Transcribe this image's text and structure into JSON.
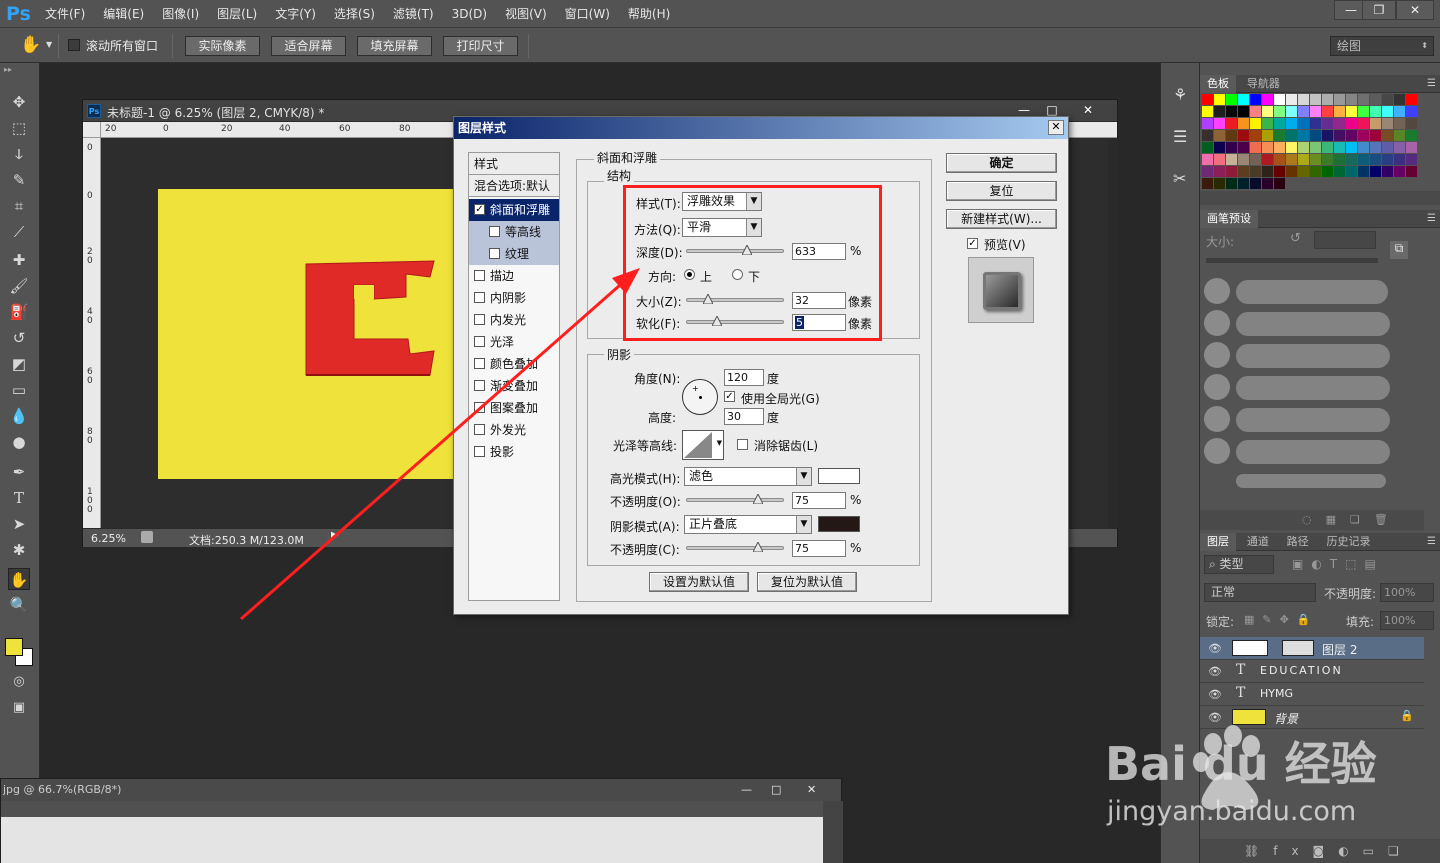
{
  "menubar": {
    "logo": "Ps",
    "items": [
      "文件(F)",
      "编辑(E)",
      "图像(I)",
      "图层(L)",
      "文字(Y)",
      "选择(S)",
      "滤镜(T)",
      "3D(D)",
      "视图(V)",
      "窗口(W)",
      "帮助(H)"
    ],
    "window_controls": [
      "—",
      "❐",
      "✕"
    ]
  },
  "options": {
    "scroll_all": "滚动所有窗口",
    "actual_pixels": "实际像素",
    "fit_screen": "适合屏幕",
    "fill_screen": "填充屏幕",
    "print_size": "打印尺寸",
    "workspace": "绘图"
  },
  "document": {
    "title": "未标题-1 @ 6.25% (图层 2, CMYK/8) *",
    "badge": "Ps",
    "zoom": "6.25%",
    "doc_info": "文档:250.3 M/123.0M",
    "ruler_h": [
      "20",
      "0",
      "20",
      "40",
      "60",
      "80"
    ],
    "ruler_v": [
      "0",
      "0",
      "20",
      "40",
      "60",
      "80",
      "100"
    ],
    "controls": [
      "—",
      "□",
      "✕"
    ]
  },
  "document2": {
    "title": "jpg @ 66.7%(RGB/8*)",
    "controls": [
      "—",
      "□",
      "✕"
    ]
  },
  "panels": {
    "swatches_tabs": [
      "色板",
      "导航器"
    ],
    "brush_tab": "画笔预设",
    "brush_size_label": "大小:",
    "layers_tabs": [
      "图层",
      "通道",
      "路径",
      "历史记录"
    ],
    "filter_type": "类型",
    "blend_mode": "正常",
    "opacity_label": "不透明度:",
    "opacity_value": "100%",
    "lock_label": "锁定:",
    "fill_label": "填充:",
    "fill_value": "100%",
    "layers": [
      {
        "name": "图层 2",
        "kind": "image"
      },
      {
        "name": "EDUCATION",
        "kind": "text"
      },
      {
        "name": "HYMG",
        "kind": "text"
      },
      {
        "name": "背景",
        "kind": "background"
      }
    ],
    "swatch_colors": [
      "#ff0000",
      "#ffff00",
      "#00ff00",
      "#00ffff",
      "#0000ff",
      "#ff00ff",
      "#ffffff",
      "#ebebeb",
      "#d6d6d6",
      "#c2c2c2",
      "#adadad",
      "#999999",
      "#858585",
      "#707070",
      "#5c5c5c",
      "#474747",
      "#333333",
      "#ff0000",
      "#ffff00",
      "#1f1f1f",
      "#0a0a0a",
      "#000000",
      "#ff8080",
      "#ffff80",
      "#80ff80",
      "#80ffff",
      "#8080ff",
      "#ff80ff",
      "#ff4040",
      "#ffb040",
      "#ffff40",
      "#40ff40",
      "#40ffb0",
      "#40ffff",
      "#40b0ff",
      "#4040ff",
      "#b040ff",
      "#ff40ff",
      "#ed1c24",
      "#f7941d",
      "#fff200",
      "#39b54a",
      "#00a99d",
      "#00aeef",
      "#0072bc",
      "#2e3192",
      "#662d91",
      "#92278f",
      "#ec008c",
      "#ed145b",
      "#c69c6d",
      "#998675",
      "#736357",
      "#534741",
      "#362f2d",
      "#8c6239",
      "#603913",
      "#9e0b0f",
      "#a0410d",
      "#aba000",
      "#197b30",
      "#00746b",
      "#0076a3",
      "#004a80",
      "#1b1464",
      "#440e62",
      "#630460",
      "#9e005d",
      "#9e0039",
      "#754c24",
      "#598527",
      "#1a7b30",
      "#005e20",
      "#0d004c",
      "#32004b",
      "#4b0049",
      "#f26c4f",
      "#f68e55",
      "#fbaf5c",
      "#fff467",
      "#acd372",
      "#7cc576",
      "#3bb878",
      "#1abbb4",
      "#00bff3",
      "#438ccb",
      "#5574b9",
      "#605ca8",
      "#855fa8",
      "#a763a8",
      "#f06ea9",
      "#f26d7d",
      "#c7b299",
      "#998675",
      "#736357",
      "#aa1b22",
      "#a8521b",
      "#ab7a1b",
      "#adaa1a",
      "#6b8e23",
      "#3a7d28",
      "#1e6f38",
      "#16695c",
      "#0c5c7a",
      "#1a4e82",
      "#2a3f83",
      "#3a2f80",
      "#552b80",
      "#6e2a74",
      "#8a1f5a",
      "#8f1b3a",
      "#5c3d1e",
      "#4a3a28",
      "#2e2318",
      "#660000",
      "#663300",
      "#666600",
      "#336600",
      "#006600",
      "#006633",
      "#006666",
      "#003366",
      "#000066",
      "#330066",
      "#660066",
      "#660033",
      "#3a1a0a",
      "#2a2a00",
      "#002a1a",
      "#00202a",
      "#0a0a2a",
      "#2a002a",
      "#2a0010"
    ]
  },
  "dialog": {
    "title": "图层样式",
    "styles": [
      {
        "label": "样式",
        "checkbox": false,
        "state": "header"
      },
      {
        "label": "混合选项:默认",
        "checkbox": false,
        "state": "header"
      },
      {
        "label": "斜面和浮雕",
        "checkbox": true,
        "checked": true,
        "state": "selected"
      },
      {
        "label": "等高线",
        "checkbox": true,
        "checked": false,
        "state": "sub"
      },
      {
        "label": "纹理",
        "checkbox": true,
        "checked": false,
        "state": "sub"
      },
      {
        "label": "描边",
        "checkbox": true,
        "checked": false,
        "state": "normal"
      },
      {
        "label": "内阴影",
        "checkbox": true,
        "checked": false,
        "state": "normal"
      },
      {
        "label": "内发光",
        "checkbox": true,
        "checked": false,
        "state": "normal"
      },
      {
        "label": "光泽",
        "checkbox": true,
        "checked": false,
        "state": "normal"
      },
      {
        "label": "颜色叠加",
        "checkbox": true,
        "checked": false,
        "state": "normal"
      },
      {
        "label": "渐变叠加",
        "checkbox": true,
        "checked": false,
        "state": "normal"
      },
      {
        "label": "图案叠加",
        "checkbox": true,
        "checked": false,
        "state": "normal"
      },
      {
        "label": "外发光",
        "checkbox": true,
        "checked": false,
        "state": "normal"
      },
      {
        "label": "投影",
        "checkbox": true,
        "checked": false,
        "state": "normal"
      }
    ],
    "bevel_title": "斜面和浮雕",
    "structure_title": "结构",
    "style_label": "样式(T):",
    "style_value": "浮雕效果",
    "technique_label": "方法(Q):",
    "technique_value": "平滑",
    "depth_label": "深度(D):",
    "depth_value": "633",
    "depth_fraction": 0.62,
    "percent": "%",
    "direction_label": "方向:",
    "dir_up": "上",
    "dir_down": "下",
    "size_label": "大小(Z):",
    "size_value": "32",
    "size_fraction": 0.18,
    "px_unit": "像素",
    "soften_label": "软化(F):",
    "soften_value": "5",
    "soften_fraction": 0.28,
    "shading_title": "阴影",
    "angle_label": "角度(N):",
    "angle_value": "120",
    "degree_unit": "度",
    "global_light": "使用全局光(G)",
    "altitude_label": "高度:",
    "altitude_value": "30",
    "gloss_label": "光泽等高线:",
    "anti_alias": "消除锯齿(L)",
    "highlight_label": "高光模式(H):",
    "highlight_value": "滤色",
    "highlight_color": "#ffffff",
    "hl_opacity_label": "不透明度(O):",
    "hl_opacity_value": "75",
    "hl_opacity_fraction": 0.75,
    "shadow_label": "阴影模式(A):",
    "shadow_value": "正片叠底",
    "shadow_color": "#231815",
    "sh_opacity_label": "不透明度(C):",
    "sh_opacity_value": "75",
    "sh_opacity_fraction": 0.75,
    "make_default": "设置为默认值",
    "reset_default": "复位为默认值",
    "ok": "确定",
    "reset": "复位",
    "new_style": "新建样式(W)...",
    "preview": "预览(V)"
  },
  "watermark": {
    "brand": "Bai du 经验",
    "url": "jingyan.baidu.com"
  },
  "colors": {
    "canvas_yellow": "#efe23a",
    "logo_red": "#e02a28",
    "annotation_red": "#ff1e1e",
    "ps_blue": "#2fa3f5"
  }
}
